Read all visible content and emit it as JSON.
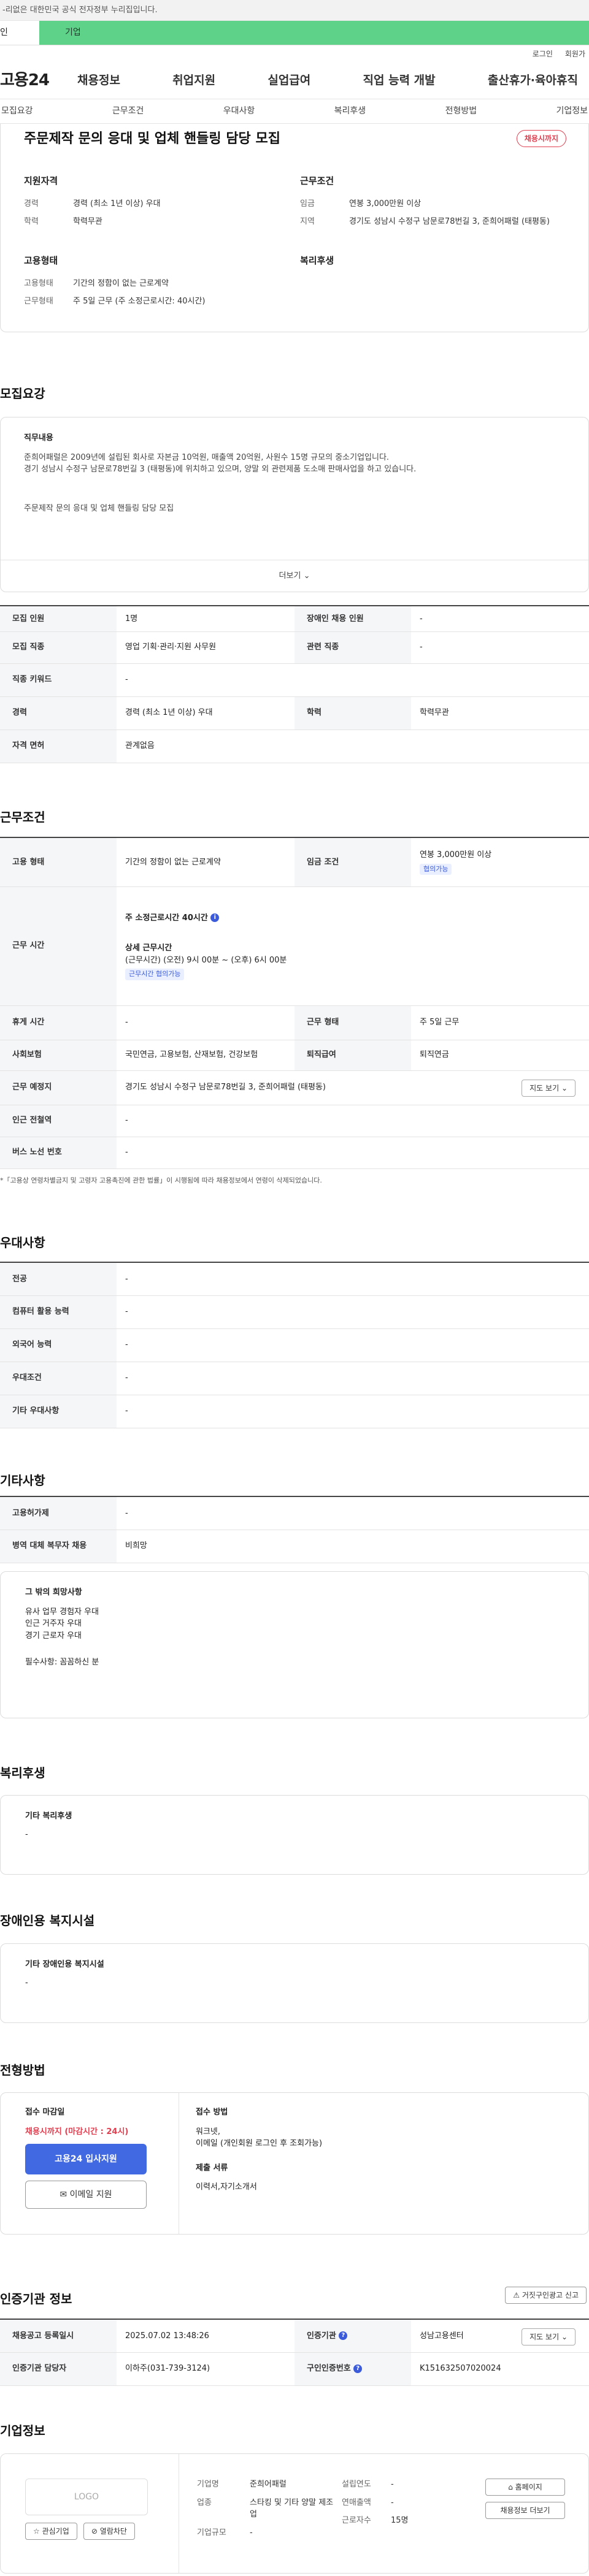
{
  "gov_banner": "-리없은 대한민국 공식 전자정부 누리집입니다.",
  "top_tabs": {
    "individual": "인",
    "company": "기업"
  },
  "util": {
    "login": "로그인",
    "join": "회원가"
  },
  "logo": "고용24",
  "gnb": [
    "채용정보",
    "취업지원",
    "실업급여",
    "직업 능력 개발",
    "출산휴가·육아휴직"
  ],
  "subnav": [
    "모집요강",
    "근무조건",
    "우대사항",
    "복리후생",
    "전형방법",
    "기업정보"
  ],
  "header": {
    "title": "주문제작 문의 응대 및 업체 핸들링 담당 모집",
    "badge": "채용시까지",
    "qual_h": "지원자격",
    "career_k": "경력",
    "career_v": "경력 (최소 1년 이상) 우대",
    "edu_k": "학력",
    "edu_v": "학력무관",
    "cond_h": "근무조건",
    "pay_k": "임금",
    "pay_v": "연봉 3,000만원 이상",
    "area_k": "지역",
    "area_v": "경기도 성남시 수정구 남문로78번길 3, 준희어패럴 (태평동)",
    "emp_h": "고용형태",
    "type_k": "고용형태",
    "type_v": "기간의 정함이 없는 근로계약",
    "work_k": "근무형태",
    "work_v": "주 5일 근무 (주 소정근로시간: 40시간)",
    "welfare_h": "복리후생"
  },
  "recruit": {
    "section": "모집요강",
    "job_h": "직무내용",
    "desc1": "준희어패럴은 2009년에 설립된 회사로 자본금 10억원, 매출액 20억원, 사원수 15명 규모의 중소기업입니다.",
    "desc2": "경기 성남시 수정구 남문로78번길 3 (태평동)에 위치하고 있으며, 양말 외 관련제품 도소매 판매사업을 하고 있습니다.",
    "desc3": "주문제작 문의 응대 및 업체 핸들링 담당 모집",
    "more": "더보기",
    "rows": [
      [
        "모집 인원",
        "1명",
        "장애인 채용 인원",
        "-"
      ],
      [
        "모집 직종",
        "영업 기획·관리·지원 사무원",
        "관련 직종",
        "-"
      ],
      [
        "직종 키워드",
        "-",
        "",
        ""
      ],
      [
        "경력",
        "경력 (최소 1년 이상) 우대",
        "학력",
        "학력무관"
      ],
      [
        "자격 면허",
        "관계없음",
        "",
        ""
      ]
    ]
  },
  "work": {
    "section": "근무조건",
    "type_k": "고용 형태",
    "type_v": "기간의 정함이 없는 근로계약",
    "pay_k": "임금 조건",
    "pay_v": "연봉 3,000만원 이상",
    "pay_tag": "협의가능",
    "time_k": "근무 시간",
    "time_main": "주 소정근로시간 40시간",
    "detail_h": "상세 근무시간",
    "detail_v": "(근무시간) (오전) 9시 00분 ~ (오후) 6시 00분",
    "time_tag": "근무시간 협의가능",
    "rest_k": "휴게 시간",
    "rest_v": "-",
    "form_k": "근무 형태",
    "form_v": "주 5일 근무",
    "ins_k": "사회보험",
    "ins_v": "국민연금, 고용보험, 산재보험, 건강보험",
    "ret_k": "퇴직급여",
    "ret_v": "퇴직연금",
    "place_k": "근무 예정지",
    "place_v": "경기도 성남시 수정구 남문로78번길 3, 준희어패럴 (태평동)",
    "map_btn": "지도 보기",
    "station_k": "인근 전철역",
    "station_v": "-",
    "bus_k": "버스 노선 번호",
    "bus_v": "-",
    "note": "*「고용상 연령차별금지 및 고령자 고용촉진에 관한 법률」이 시행됨에 따라 채용정보에서 연령이 삭제되었습니다."
  },
  "pref": {
    "section": "우대사항",
    "rows": [
      [
        "전공",
        "-"
      ],
      [
        "컴퓨터 활용 능력",
        "-"
      ],
      [
        "외국어 능력",
        "-"
      ],
      [
        "우대조건",
        "-"
      ],
      [
        "기타 우대사항",
        "-"
      ]
    ]
  },
  "etc": {
    "section": "기타사항",
    "rows": [
      [
        "고용허가제",
        "-"
      ],
      [
        "병역 대체 복무자 채용",
        "비희망"
      ]
    ],
    "box_h": "그 밖의 희망사항",
    "lines": [
      "유사 업무 경험자 우대",
      "인근 거주자 우대",
      "경기 근로자 우대"
    ],
    "extra": "필수사항: 꼼꼼하신 분"
  },
  "welfare": {
    "section": "복리후생",
    "box_h": "기타 복리후생",
    "box_v": "-"
  },
  "disabled": {
    "section": "장애인용 복지시설",
    "box_h": "기타 장애인용 복지시설",
    "box_v": "-"
  },
  "process": {
    "section": "전형방법",
    "deadline_h": "접수 마감일",
    "deadline_v": "채용시까지 (마감시간 : 24시)",
    "apply_btn": "고용24 입사지원",
    "email_btn": "이메일 지원",
    "method_h": "접수 방법",
    "method_v1": "워크넷,",
    "method_v2": "이메일 (개인회원 로그인 후 조회가능)",
    "docs_h": "제출 서류",
    "docs_v": "이력서,자기소개서"
  },
  "agency": {
    "section": "인증기관 정보",
    "report_btn": "거짓구인광고 신고",
    "reg_k": "채용공고 등록일시",
    "reg_v": "2025.07.02 13:48:26",
    "org_k": "인증기관",
    "org_v": "성남고용센터",
    "map_btn": "지도 보기",
    "mgr_k": "인증기관 담당자",
    "mgr_v": "이하주(031-739-3124)",
    "no_k": "구인인증번호",
    "no_v": "K151632507020024"
  },
  "company": {
    "section": "기업정보",
    "logo_ph": "LOGO",
    "fav_btn": "관심기업",
    "block_btn": "열람차단",
    "name_k": "기업명",
    "name_v": "준희어패럴",
    "ind_k": "업종",
    "ind_v": "스타킹 및 기타 양말 제조업",
    "size_k": "기업규모",
    "size_v": "-",
    "est_k": "설립연도",
    "est_v": "-",
    "sales_k": "연매출액",
    "sales_v": "-",
    "emp_k": "근로자수",
    "emp_v": "15명",
    "home_btn": "홈페이지",
    "jobs_btn": "채용정보 더보기"
  }
}
